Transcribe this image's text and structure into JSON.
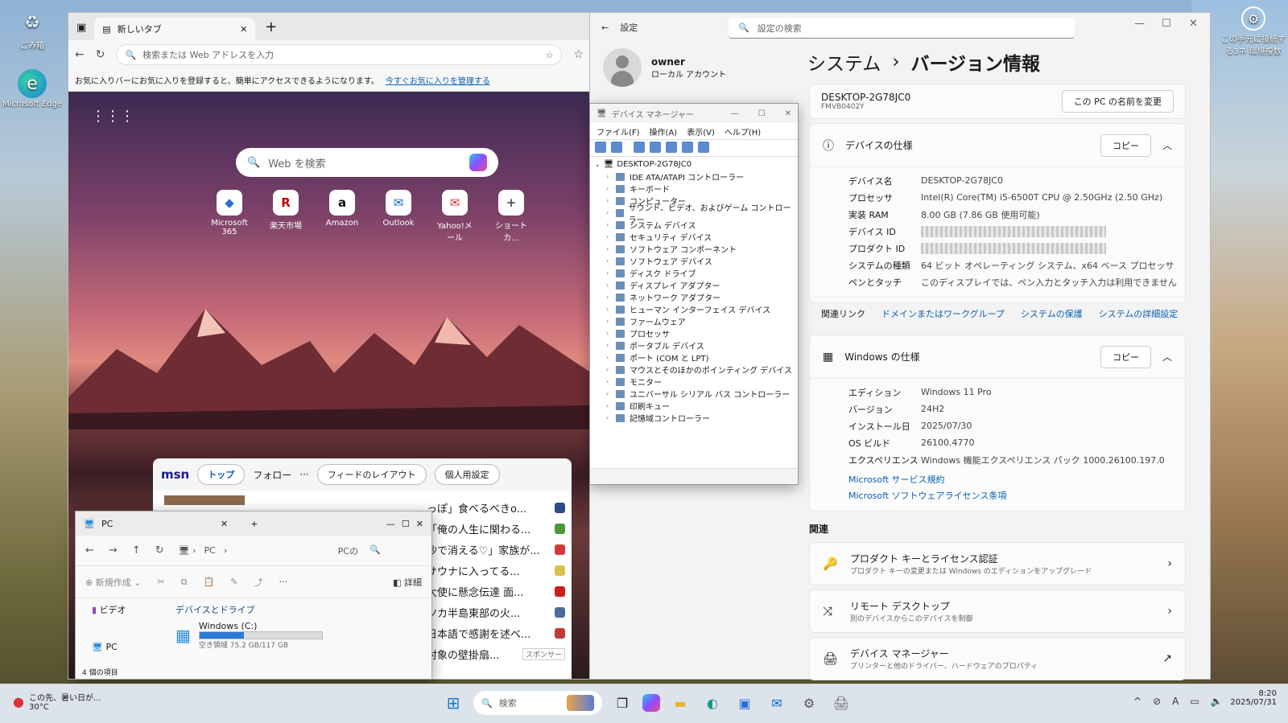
{
  "desktop": {
    "recycle_label": "ごみ箱",
    "edge_label": "Microsoft Edge",
    "remote_label": "この手元に接続する3ネ 環境複数"
  },
  "edge": {
    "tab_title": "新しいタブ",
    "address_placeholder": "検索または Web アドレスを入力",
    "fav_text": "お気に入りバーにお気に入りを登録すると、簡単にアクセスできるようになります。",
    "fav_link": "今すぐお気に入りを管理する",
    "web_search_placeholder": "Web を検索",
    "tiles": [
      {
        "label": "Microsoft 365",
        "glyph": "◆",
        "color": "#2b6fd6"
      },
      {
        "label": "楽天市場",
        "glyph": "R",
        "color": "#bf0000"
      },
      {
        "label": "Amazon",
        "glyph": "a",
        "color": "#111"
      },
      {
        "label": "Outlook",
        "glyph": "✉",
        "color": "#0a64c8"
      },
      {
        "label": "Yahoo!メール",
        "glyph": "✉",
        "color": "#d0333a"
      },
      {
        "label": "ショートカ...",
        "glyph": "+",
        "color": "#555"
      }
    ],
    "msn": {
      "logo": "msn",
      "tab_top": "トップ",
      "tab_follow": "フォロー",
      "more": "···",
      "feed_layout": "フィードのレイアウト",
      "personalize": "個人用設定",
      "sponsor": "スポンサー"
    },
    "news": [
      "っぽ」食べるべきo...",
      "「俺の人生に関わる...",
      "沙で消える♡」家族が...",
      "サウナに入ってる...",
      "大使に懸念伝達 面...",
      "ツカ半島東部の火...",
      "日本語で感謝を述べ...",
      "対象の壁掛扇..."
    ],
    "news_badges": [
      "#2a4a8a",
      "#4c9a3a",
      "#d23a3a",
      "#d9c24a",
      "#c81e1e",
      "#4c6a9a",
      "#c23a3a",
      ""
    ]
  },
  "explorer": {
    "tab_title": "PC",
    "path": "PC",
    "search_placeholder": "PCの",
    "new_label": "新規作成",
    "details_label": "詳細",
    "sidebar_item": "ビデオ",
    "sidebar_pc": "PC",
    "group": "デバイスとドライブ",
    "drive_name": "Windows (C:)",
    "drive_free": "空き領域 75.2 GB/117 GB",
    "drive_used_fraction": 0.36,
    "status": "4 個の項目"
  },
  "devmgr": {
    "title": "デバイス マネージャー",
    "menu": [
      "ファイル(F)",
      "操作(A)",
      "表示(V)",
      "ヘルプ(H)"
    ],
    "root": "DESKTOP-2G78JC0",
    "nodes": [
      "IDE ATA/ATAPI コントローラー",
      "キーボード",
      "コンピューター",
      "サウンド、ビデオ、およびゲーム コントローラー",
      "システム デバイス",
      "セキュリティ デバイス",
      "ソフトウェア コンポーネント",
      "ソフトウェア デバイス",
      "ディスク ドライブ",
      "ディスプレイ アダプター",
      "ネットワーク アダプター",
      "ヒューマン インターフェイス デバイス",
      "ファームウェア",
      "プロセッサ",
      "ポータブル デバイス",
      "ポート (COM と LPT)",
      "マウスとそのほかのポインティング デバイス",
      "モニター",
      "ユニバーサル シリアル バス コントローラー",
      "印刷キュー",
      "記憶域コントローラー"
    ]
  },
  "settings": {
    "app_title": "設定",
    "search_placeholder": "設定の検索",
    "user_name": "owner",
    "account_type": "ローカル アカウント",
    "crumb_parent": "システム",
    "crumb_sep": "›",
    "crumb_current": "バージョン情報",
    "pc_name": "DESKTOP-2G78JC0",
    "pc_model": "FMVB0402Y",
    "rename_button": "この PC の名前を変更",
    "device_spec_title": "デバイスの仕様",
    "copy": "コピー",
    "device_specs": [
      {
        "k": "デバイス名",
        "v": "DESKTOP-2G78JC0"
      },
      {
        "k": "プロセッサ",
        "v": "Intel(R) Core(TM) i5-6500T CPU @ 2.50GHz (2.50 GHz)"
      },
      {
        "k": "実装 RAM",
        "v": "8.00 GB (7.86 GB 使用可能)"
      },
      {
        "k": "デバイス ID",
        "v": ""
      },
      {
        "k": "プロダクト ID",
        "v": ""
      },
      {
        "k": "システムの種類",
        "v": "64 ビット オペレーティング システム、x64 ベース プロセッサ"
      },
      {
        "k": "ペンとタッチ",
        "v": "このディスプレイでは、ペン入力とタッチ入力は利用できません"
      }
    ],
    "related_links_label": "関連リンク",
    "related_links": [
      "ドメインまたはワークグループ",
      "システムの保護",
      "システムの詳細設定"
    ],
    "windows_spec_title": "Windows の仕様",
    "windows_specs": [
      {
        "k": "エディション",
        "v": "Windows 11 Pro"
      },
      {
        "k": "バージョン",
        "v": "24H2"
      },
      {
        "k": "インストール日",
        "v": "2025/07/30"
      },
      {
        "k": "OS ビルド",
        "v": "26100.4770"
      },
      {
        "k": "エクスペリエンス",
        "v": "Windows 機能エクスペリエンス パック 1000.26100.197.0"
      }
    ],
    "ms_links": [
      "Microsoft サービス規約",
      "Microsoft ソフトウェアライセンス条項"
    ],
    "related_heading": "関連",
    "related_items": [
      {
        "t": "プロダクト キーとライセンス認証",
        "s": "プロダクト キーの変更または Windows のエディションをアップグレード",
        "icon": "🔑",
        "arrow": "›"
      },
      {
        "t": "リモート デスクトップ",
        "s": "別のデバイスからこのデバイスを制御",
        "icon": "⤨",
        "arrow": "›"
      },
      {
        "t": "デバイス マネージャー",
        "s": "プリンターと他のドライバー、ハードウェアのプロパティ",
        "icon": "🖨",
        "arrow": "↗"
      }
    ]
  },
  "taskbar": {
    "weather_text": "この先、暑い日が...",
    "weather_temp": "30°C",
    "search_placeholder": "検索",
    "time": "8:20",
    "date": "2025/07/31"
  }
}
